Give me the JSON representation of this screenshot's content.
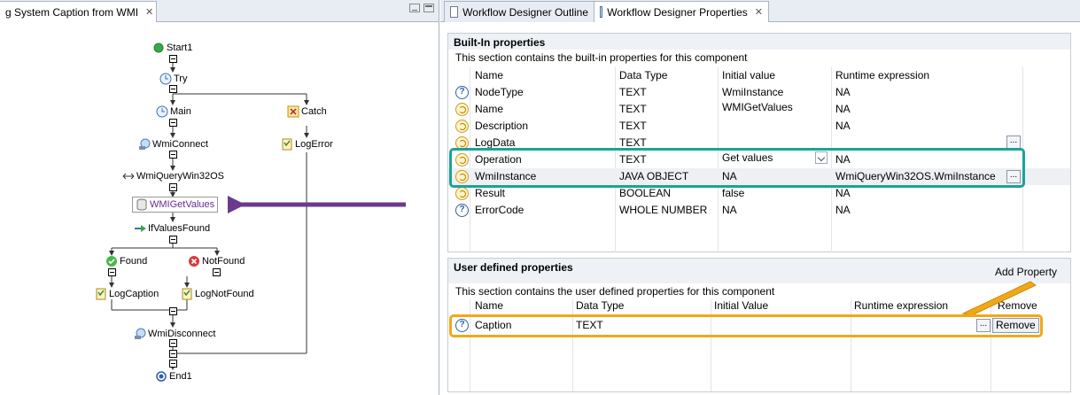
{
  "editor": {
    "tab_title": "g System Caption from WMI",
    "nodes": {
      "start": "Start1",
      "try": "Try",
      "main": "Main",
      "catch": "Catch",
      "wmiconnect": "WmiConnect",
      "logerror": "LogError",
      "wmiquery": "WmiQueryWin32OS",
      "wmigetvalues": "WMIGetValues",
      "ifvalues": "IfValuesFound",
      "found": "Found",
      "notfound": "NotFound",
      "logcaption": "LogCaption",
      "lognotfound": "LogNotFound",
      "wmidisconnect": "WmiDisconnect",
      "end": "End1"
    }
  },
  "panel": {
    "tabs": [
      "Workflow Designer Outline",
      "Workflow Designer Properties"
    ],
    "builtin": {
      "title": "Built-In properties",
      "description": "This section contains the built-in properties for this component",
      "columns": [
        "Name",
        "Data Type",
        "Initial value",
        "Runtime expression"
      ],
      "rows": [
        {
          "icon": "help-icon",
          "name": "NodeType",
          "type": "TEXT",
          "initial": "WmiInstance",
          "runtime": "NA"
        },
        {
          "icon": "expression-icon",
          "name": "Name",
          "type": "TEXT",
          "initial": "WMIGetValues",
          "runtime": "NA"
        },
        {
          "icon": "expression-icon",
          "name": "Description",
          "type": "TEXT",
          "initial": "",
          "runtime": "NA"
        },
        {
          "icon": "expression-icon",
          "name": "LogData",
          "type": "TEXT",
          "initial": "",
          "runtime": ""
        },
        {
          "icon": "expression-icon",
          "name": "Operation",
          "type": "TEXT",
          "initial": "Get values",
          "runtime": "NA"
        },
        {
          "icon": "expression-icon",
          "name": "WmiInstance",
          "type": "JAVA OBJECT",
          "initial": "NA",
          "runtime": "WmiQueryWin32OS.WmiInstance"
        },
        {
          "icon": "expression-icon",
          "name": "Result",
          "type": "BOOLEAN",
          "initial": "false",
          "runtime": "NA"
        },
        {
          "icon": "help-icon",
          "name": "ErrorCode",
          "type": "WHOLE NUMBER",
          "initial": "NA",
          "runtime": "NA"
        }
      ]
    },
    "user": {
      "title": "User defined properties",
      "add_label": "Add Property",
      "description": "This section contains the user defined properties for this component",
      "columns": [
        "Name",
        "Data Type",
        "Initial Value",
        "Runtime expression",
        "Remove"
      ],
      "rows": [
        {
          "icon": "help-icon",
          "name": "Caption",
          "type": "TEXT",
          "initial": "",
          "runtime": "",
          "remove": "Remove"
        }
      ]
    },
    "dots_label": "..."
  },
  "colors": {
    "highlight_teal": "#1aa39a",
    "highlight_orange": "#f0a818",
    "arrow_purple": "#6b3a8c"
  }
}
